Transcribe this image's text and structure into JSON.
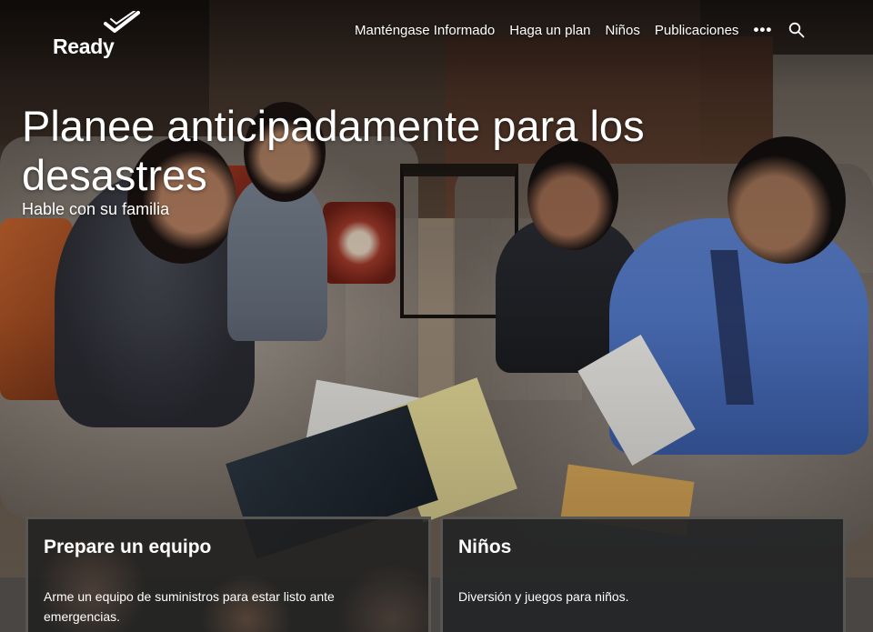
{
  "logo": {
    "text": "Ready",
    "icon": "checkmark-icon"
  },
  "nav": {
    "items": [
      {
        "label": "Manténgase Informado"
      },
      {
        "label": "Haga un plan"
      },
      {
        "label": "Niños"
      },
      {
        "label": "Publicaciones"
      }
    ],
    "more_label": "•••",
    "search_icon": "search-icon"
  },
  "hero": {
    "title": "Planee anticipadamente para los desastres",
    "subtitle": "Hable con su familia"
  },
  "cards": [
    {
      "title": "Prepare un equipo",
      "description": "Arme un equipo de suministros para estar listo ante emergencias."
    },
    {
      "title": "Niños",
      "description": "Diversión y juegos para niños."
    }
  ],
  "colors": {
    "text": "#ffffff",
    "card_bg": "#202020",
    "card_border": "#585653"
  }
}
